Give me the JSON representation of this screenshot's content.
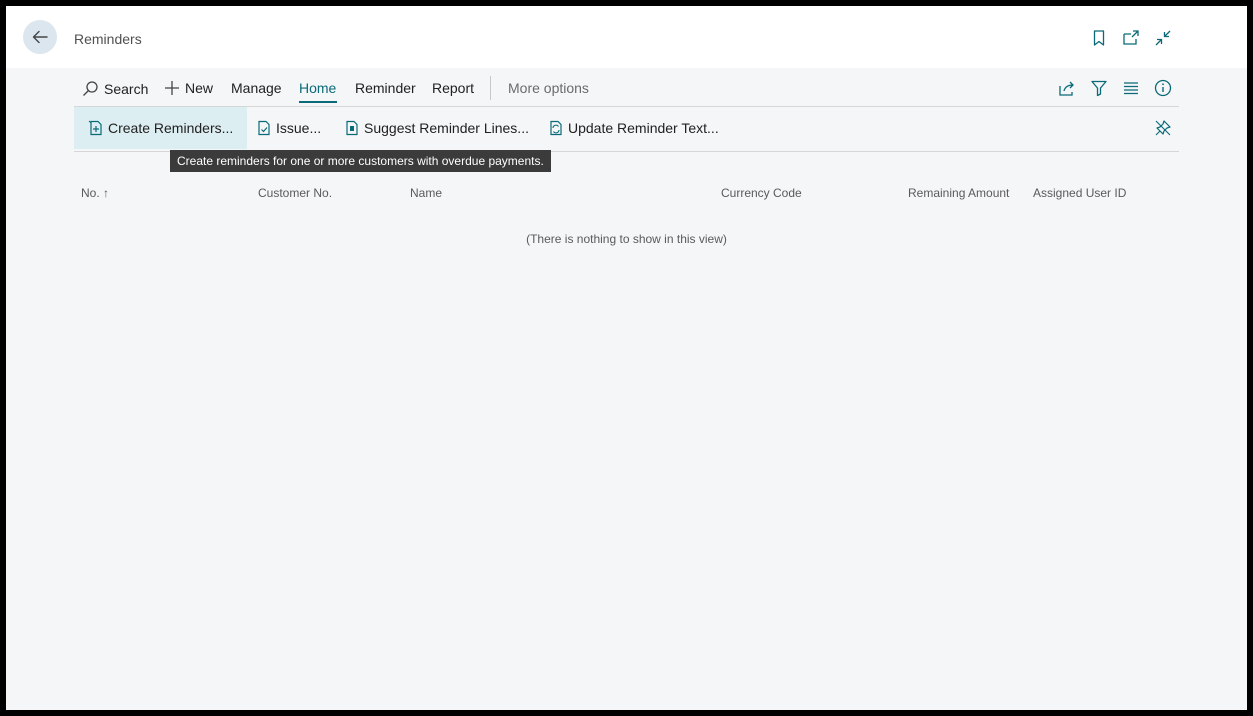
{
  "header": {
    "title": "Reminders",
    "icons": [
      "back-arrow-icon",
      "bookmark-icon",
      "open-new-window-icon",
      "collapse-icon"
    ]
  },
  "action_bar": {
    "search_label": "Search",
    "new_label": "New",
    "manage_label": "Manage",
    "home_label": "Home",
    "reminder_label": "Reminder",
    "report_label": "Report",
    "more_options_label": "More options",
    "icons": [
      "share-icon",
      "filter-icon",
      "list-view-icon",
      "info-icon"
    ]
  },
  "sub_actions": {
    "create_reminders_label": "Create Reminders...",
    "issue_label": "Issue...",
    "suggest_lines_label": "Suggest Reminder Lines...",
    "update_text_label": "Update Reminder Text..."
  },
  "tooltip": {
    "text": "Create reminders for one or more customers with overdue payments."
  },
  "table": {
    "columns": [
      "No. ↑",
      "Customer No.",
      "Name",
      "Currency Code",
      "Remaining Amount",
      "Assigned User ID"
    ],
    "empty_message": "(There is nothing to show in this view)"
  },
  "colors": {
    "accent": "#0b6a78",
    "background": "#f4f6f8",
    "header_bg": "#ffffff",
    "tooltip_bg": "#3b3b3b"
  }
}
